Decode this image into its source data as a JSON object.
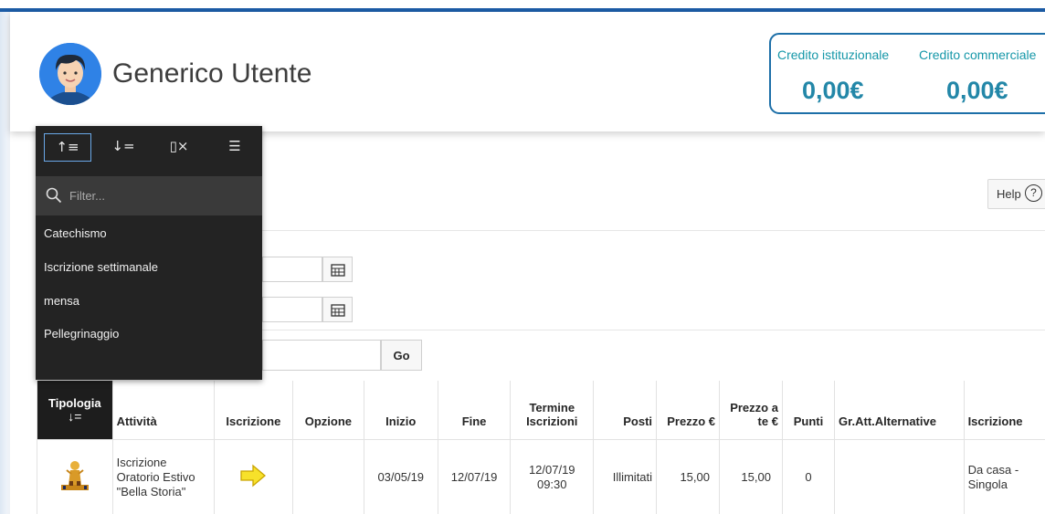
{
  "header": {
    "user_name": "Generico Utente",
    "credits": [
      {
        "label": "Credito istituzionale",
        "value": "0,00€"
      },
      {
        "label": "Credito commerciale",
        "value": "0,00€"
      }
    ],
    "help_label": "Help",
    "help_icon": "question-circle-icon"
  },
  "column_menu": {
    "tools": [
      {
        "icon": "sort-ascending-icon",
        "glyph": "↑≡"
      },
      {
        "icon": "sort-descending-icon",
        "glyph": "↓="
      },
      {
        "icon": "hide-column-icon",
        "glyph": "▯×"
      },
      {
        "icon": "control-break-icon",
        "glyph": "☰"
      }
    ],
    "filter_placeholder": "Filter...",
    "items": [
      "Catechismo",
      "Iscrizione settimanale",
      "mensa",
      "Pellegrinaggio"
    ]
  },
  "search": {
    "go_label": "Go"
  },
  "table": {
    "sorted_column": {
      "label": "Tipologia",
      "sort_indicator": "↓="
    },
    "headers": [
      "Attività",
      "Iscrizione",
      "Opzione",
      "Inizio",
      "Fine",
      "Termine Iscrizioni",
      "Posti",
      "Prezzo €",
      "Prezzo a te €",
      "Punti",
      "Gr.Att.Alternative",
      "Iscrizione"
    ],
    "rows": [
      {
        "attivita": "Iscrizione Oratorio Estivo \"Bella Storia\"",
        "opzione": "",
        "inizio": "03/05/19",
        "fine": "12/07/19",
        "termine": "12/07/19 09:30",
        "posti": "Illimitati",
        "prezzo": "15,00",
        "prezzo_a_te": "15,00",
        "punti": "0",
        "gr_alternative": "",
        "iscrizione_tipo": "Da casa - Singola"
      }
    ]
  },
  "colors": {
    "accent": "#1c5ca6",
    "credit_text": "#1597a8",
    "menu_bg": "#232323",
    "arrow_yellow": "#f7e12a"
  }
}
